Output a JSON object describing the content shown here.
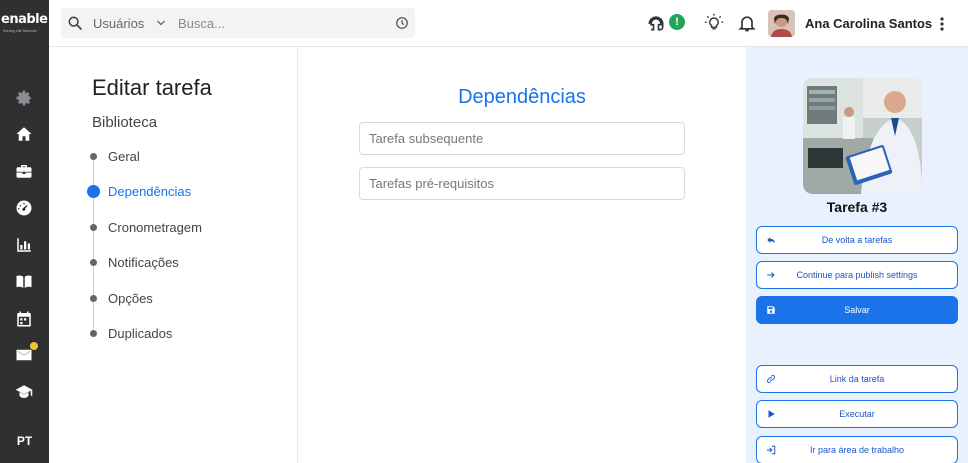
{
  "brand": {
    "name": "enable",
    "tagline": "Serving Life Sciences"
  },
  "sidebar": {
    "items": [
      {
        "icon": "gear-icon",
        "dim": true
      },
      {
        "icon": "home-icon"
      },
      {
        "icon": "briefcase-icon"
      },
      {
        "icon": "gauge-icon"
      },
      {
        "icon": "bar-chart-icon"
      },
      {
        "icon": "book-icon"
      },
      {
        "icon": "calendar-icon"
      },
      {
        "icon": "mail-icon",
        "badge": true
      },
      {
        "icon": "graduation-cap-icon"
      }
    ],
    "language": "PT"
  },
  "topbar": {
    "search_scope": "Usuários",
    "search_placeholder": "Busca...",
    "status_badge": "!",
    "user_name": "Ana Carolina Santos"
  },
  "nav": {
    "page_title": "Editar tarefa",
    "section_title": "Biblioteca",
    "steps": [
      {
        "label": "Geral",
        "active": false
      },
      {
        "label": "Dependências",
        "active": true
      },
      {
        "label": "Cronometragem",
        "active": false
      },
      {
        "label": "Notificações",
        "active": false
      },
      {
        "label": "Opções",
        "active": false
      },
      {
        "label": "Duplicados",
        "active": false
      }
    ]
  },
  "form": {
    "title": "Dependências",
    "fields": [
      {
        "placeholder": "Tarefa subsequente",
        "value": ""
      },
      {
        "placeholder": "Tarefas pré-requisitos",
        "value": ""
      }
    ]
  },
  "panel": {
    "task_title": "Tarefa #3",
    "buttons": [
      {
        "label": "De volta a tarefas",
        "icon": "reply-arrow-icon"
      },
      {
        "label": "Continue para publish settings",
        "icon": "arrow-right-icon"
      },
      {
        "label": "Salvar",
        "icon": "save-icon",
        "primary": true
      },
      {
        "label": "Link da tarefa",
        "icon": "link-icon"
      },
      {
        "label": "Executar",
        "icon": "play-icon"
      },
      {
        "label": "Ir para área de trabalho",
        "icon": "sign-in-icon"
      }
    ]
  },
  "colors": {
    "accent": "#1a73e8",
    "sidebar": "#2f3032",
    "panel": "#e9f1fe",
    "status": "#22a55b",
    "badge": "#f4c430"
  }
}
